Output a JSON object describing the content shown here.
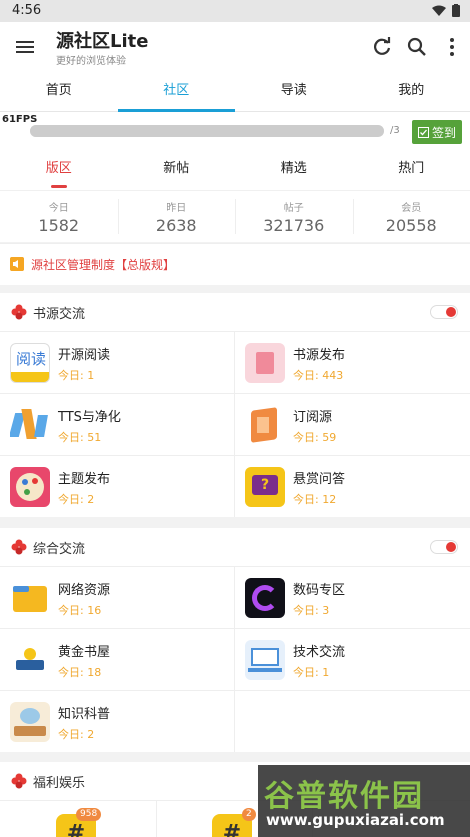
{
  "statusbar": {
    "time": "4:56"
  },
  "appbar": {
    "title": "源社区Lite",
    "subtitle": "更好的浏览体验"
  },
  "main_tabs": [
    "首页",
    "社区",
    "导读",
    "我的"
  ],
  "fps": {
    "label": "61FPS",
    "page": "/3",
    "sign_label": "签到"
  },
  "sub_tabs": [
    "版区",
    "新帖",
    "精选",
    "热门"
  ],
  "stats": [
    {
      "label": "今日",
      "value": "1582"
    },
    {
      "label": "昨日",
      "value": "2638"
    },
    {
      "label": "帖子",
      "value": "321736"
    },
    {
      "label": "会员",
      "value": "20558"
    }
  ],
  "notice": "源社区管理制度【总版规】",
  "sections": [
    {
      "title": "书源交流",
      "items": [
        {
          "name": "开源阅读",
          "today": "今日: 1"
        },
        {
          "name": "书源发布",
          "today": "今日: 443"
        },
        {
          "name": "TTS与净化",
          "today": "今日: 51"
        },
        {
          "name": "订阅源",
          "today": "今日: 59"
        },
        {
          "name": "主题发布",
          "today": "今日: 2"
        },
        {
          "name": "悬赏问答",
          "today": "今日: 12"
        }
      ]
    },
    {
      "title": "综合交流",
      "items": [
        {
          "name": "网络资源",
          "today": "今日: 16"
        },
        {
          "name": "数码专区",
          "today": "今日: 3"
        },
        {
          "name": "黄金书屋",
          "today": "今日: 18"
        },
        {
          "name": "技术交流",
          "today": "今日: 1"
        },
        {
          "name": "知识科普",
          "today": "今日: 2"
        }
      ]
    },
    {
      "title": "福利娱乐",
      "badges": [
        "958",
        "2"
      ]
    }
  ],
  "icon_labels": {
    "kaiyuan": "阅读"
  },
  "watermark": {
    "text": "谷普软件园",
    "url": "www.gupuxiazai.com"
  },
  "colors": {
    "accent": "#1a9fd6",
    "red": "#e04040",
    "green": "#56a23a",
    "orange": "#f0a830"
  }
}
